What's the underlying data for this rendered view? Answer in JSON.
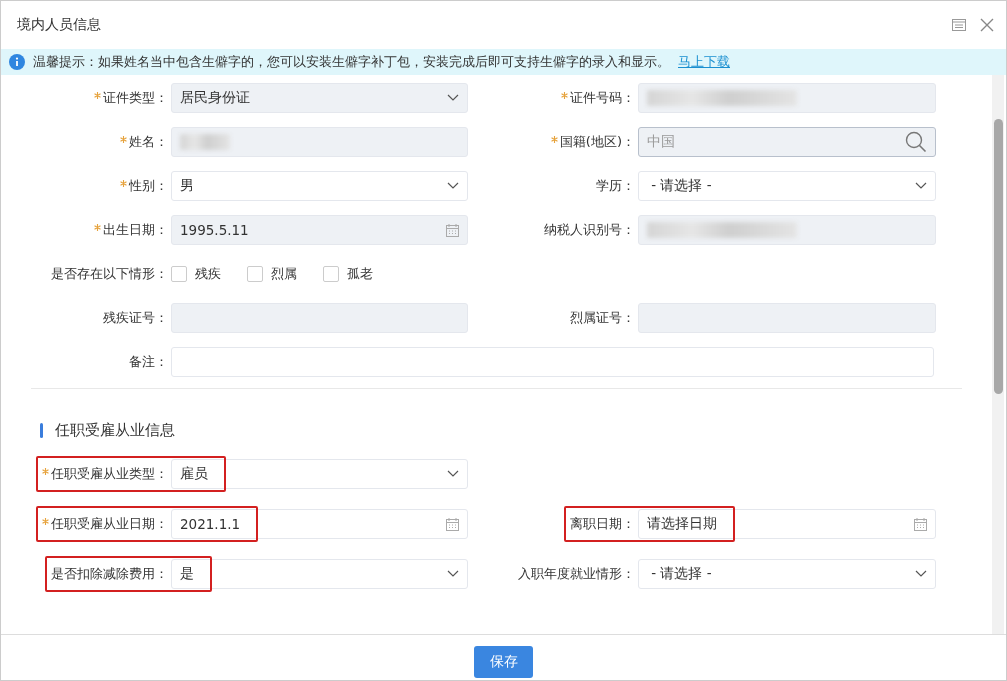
{
  "dialog": {
    "title": "境内人员信息"
  },
  "notice": {
    "text": "温馨提示：如果姓名当中包含生僻字的，您可以安装生僻字补丁包，安装完成后即可支持生僻字的录入和显示。",
    "link": "马上下载"
  },
  "basic_rows": [
    {
      "fields": [
        {
          "label": "证件类型：",
          "required": true,
          "kind": "select",
          "value": "居民身份证",
          "disabled": true,
          "blurred": false,
          "highlighted": false
        },
        {
          "label": "证件号码：",
          "required": true,
          "kind": "text",
          "disabled": true,
          "blurred": true,
          "highlighted": false
        }
      ]
    },
    {
      "fields": [
        {
          "label": "姓名：",
          "required": true,
          "kind": "text",
          "disabled": true,
          "blurred": true,
          "highlighted": false
        },
        {
          "label": "国籍(地区)：",
          "required": true,
          "kind": "search",
          "placeholder": "中国",
          "disabled": true,
          "blurred": false,
          "highlighted": false
        }
      ]
    },
    {
      "fields": [
        {
          "label": "性别：",
          "required": true,
          "kind": "select",
          "value": "男",
          "disabled": false,
          "blurred": false,
          "highlighted": false
        },
        {
          "label": "学历：",
          "required": false,
          "kind": "select",
          "value": " - 请选择 -",
          "disabled": false,
          "blurred": false,
          "highlighted": false
        }
      ]
    },
    {
      "fields": [
        {
          "label": "出生日期：",
          "required": true,
          "kind": "date",
          "value": "1995.5.11",
          "disabled": true,
          "blurred": false,
          "highlighted": false
        },
        {
          "label": "纳税人识别号：",
          "required": false,
          "kind": "text",
          "disabled": true,
          "blurred": true,
          "highlighted": false
        }
      ]
    },
    {
      "fields": [
        {
          "label": "是否存在以下情形：",
          "required": false,
          "kind": "checkboxes",
          "options": [
            {
              "label": "残疾",
              "checked": false
            },
            {
              "label": "烈属",
              "checked": false
            },
            {
              "label": "孤老",
              "checked": false
            }
          ],
          "highlighted": false
        }
      ]
    },
    {
      "fields": [
        {
          "label": "残疾证号：",
          "required": false,
          "kind": "text",
          "disabled": true,
          "blurred": false,
          "highlighted": false
        },
        {
          "label": "烈属证号：",
          "required": false,
          "kind": "text",
          "disabled": true,
          "blurred": false,
          "highlighted": false
        }
      ]
    },
    {
      "fields": [
        {
          "label": "备注：",
          "required": false,
          "kind": "text",
          "disabled": false,
          "blurred": false,
          "highlighted": false,
          "full_width": true
        }
      ]
    }
  ],
  "section_title": "任职受雇从业信息",
  "employment_rows": [
    {
      "fields": [
        {
          "label": "任职受雇从业类型：",
          "required": true,
          "kind": "select",
          "value": "雇员",
          "disabled": false,
          "blurred": false,
          "highlighted": true
        }
      ]
    },
    {
      "fields": [
        {
          "label": "任职受雇从业日期：",
          "required": true,
          "kind": "date",
          "value": "2021.1.1",
          "disabled": false,
          "blurred": false,
          "highlighted": true
        },
        {
          "label": "离职日期：",
          "required": false,
          "kind": "date",
          "value": "请选择日期",
          "disabled": false,
          "blurred": false,
          "highlighted": true
        }
      ]
    },
    {
      "fields": [
        {
          "label": "是否扣除减除费用：",
          "required": false,
          "kind": "select",
          "value": "是",
          "disabled": false,
          "blurred": false,
          "highlighted": true
        },
        {
          "label": "入职年度就业情形：",
          "required": false,
          "kind": "select",
          "value": " - 请选择 -",
          "disabled": false,
          "blurred": false,
          "highlighted": false
        }
      ]
    }
  ],
  "footer": {
    "save_button": "保存"
  }
}
